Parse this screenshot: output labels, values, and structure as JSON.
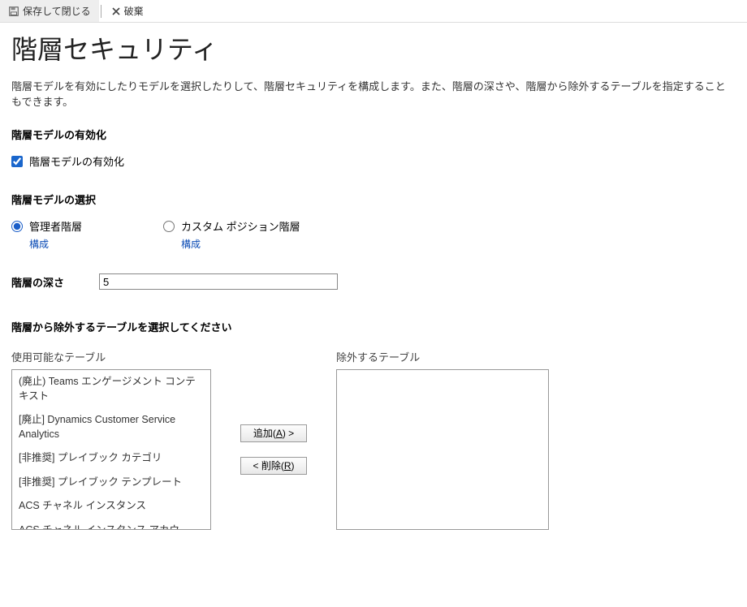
{
  "toolbar": {
    "save_close": "保存して閉じる",
    "discard": "破棄"
  },
  "page": {
    "title": "階層セキュリティ",
    "description": "階層モデルを有効にしたりモデルを選択したりして、階層セキュリティを構成します。また、階層の深さや、階層から除外するテーブルを指定することもできます。"
  },
  "enable_section": {
    "heading": "階層モデルの有効化",
    "checkbox_label": "階層モデルの有効化",
    "checked": true
  },
  "model_section": {
    "heading": "階層モデルの選択",
    "option_manager": "管理者階層",
    "option_custom": "カスタム ポジション階層",
    "config_link": "構成",
    "selected": "manager"
  },
  "depth": {
    "label": "階層の深さ",
    "value": "5"
  },
  "exclude_section": {
    "heading": "階層から除外するテーブルを選択してください",
    "available_label": "使用可能なテーブル",
    "excluded_label": "除外するテーブル",
    "add_btn_prefix": "追加(",
    "add_btn_key": "A",
    "add_btn_suffix": ") >",
    "remove_btn_prefix": "< 削除(",
    "remove_btn_key": "R",
    "remove_btn_suffix": ")",
    "available_items": [
      "(廃止) Teams エンゲージメント コンテキスト",
      "[廃止] Dynamics Customer Service Analytics",
      "[非推奨] プレイブック カテゴリ",
      "[非推奨] プレイブック テンプレート",
      "ACS チャネル インスタンス",
      "ACS チャネル インスタンス アカウ"
    ],
    "excluded_items": []
  }
}
